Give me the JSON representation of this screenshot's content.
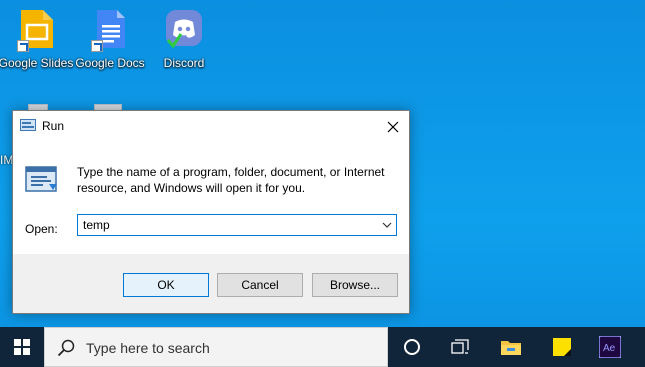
{
  "desktop": {
    "icons": [
      {
        "label": "Google Slides"
      },
      {
        "label": "Google Docs"
      },
      {
        "label": "Discord"
      }
    ],
    "partial_label": "IM"
  },
  "run_dialog": {
    "title": "Run",
    "description": "Type the name of a program, folder, document, or Internet resource, and Windows will open it for you.",
    "open_label": "Open:",
    "open_value": "temp",
    "buttons": {
      "ok": "OK",
      "cancel": "Cancel",
      "browse": "Browse..."
    }
  },
  "taskbar": {
    "search_placeholder": "Type here to search",
    "icons": [
      "windows-start-icon",
      "cortana-circle-icon",
      "task-view-icon",
      "file-explorer-icon",
      "sticky-notes-icon",
      "after-effects-icon"
    ],
    "accent_colors": {
      "taskbar": "#10253a",
      "dialog_focus": "#0078d7",
      "desktop": "#0a93e4"
    }
  }
}
